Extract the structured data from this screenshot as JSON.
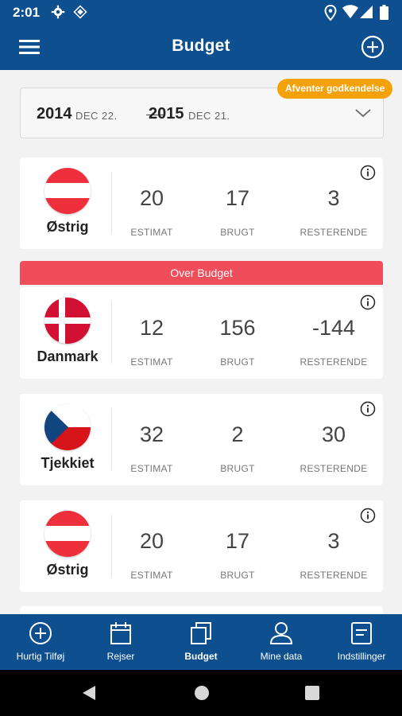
{
  "status_bar": {
    "time": "2:01",
    "icons": [
      "gear-icon",
      "diamond-icon",
      "location-icon",
      "wifi-icon",
      "signal-icon",
      "battery-icon"
    ]
  },
  "app_bar": {
    "title": "Budget",
    "menu_icon": "hamburger-menu-icon",
    "add_icon": "add-circle-icon"
  },
  "date_range": {
    "start_year": "2014",
    "start_date": "DEC 22.",
    "end_year": "2015",
    "end_date": "DEC 21.",
    "badge": "Afventer godkendelse"
  },
  "cards": [
    {
      "country": "Østrig",
      "flag": "austria",
      "over_budget": "",
      "estimate": "20",
      "used": "17",
      "remaining": "3"
    },
    {
      "country": "Danmark",
      "flag": "denmark",
      "over_budget": "Over Budget",
      "estimate": "12",
      "used": "156",
      "remaining": "-144"
    },
    {
      "country": "Tjekkiet",
      "flag": "czech",
      "over_budget": "",
      "estimate": "32",
      "used": "2",
      "remaining": "30"
    },
    {
      "country": "Østrig",
      "flag": "austria",
      "over_budget": "",
      "estimate": "20",
      "used": "17",
      "remaining": "3"
    }
  ],
  "labels": {
    "estimate": "ESTIMAT",
    "used": "BRUGT",
    "remaining": "RESTERENDE"
  },
  "bottom_nav": [
    {
      "label": "Hurtig Tilføj",
      "icon": "add-circle-icon"
    },
    {
      "label": "Rejser",
      "icon": "calendar-icon"
    },
    {
      "label": "Budget",
      "icon": "copy-icon",
      "active": true
    },
    {
      "label": "Mine data",
      "icon": "person-icon"
    },
    {
      "label": "Indstillinger",
      "icon": "document-icon"
    }
  ],
  "colors": {
    "primary": "#0d4f8f",
    "over_budget": "#ef4d5a",
    "pending_badge": "#f5a20a"
  }
}
